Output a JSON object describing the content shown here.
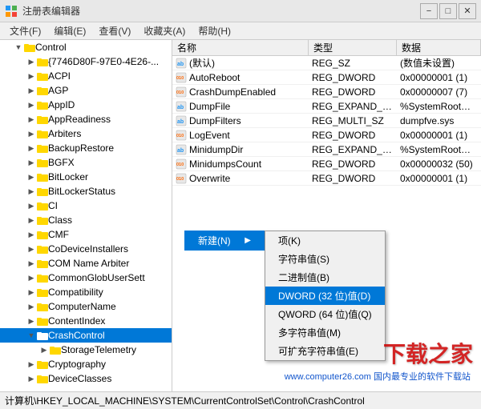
{
  "titleBar": {
    "title": "注册表编辑器",
    "minBtn": "−",
    "maxBtn": "□",
    "closeBtn": "✕"
  },
  "menuBar": {
    "items": [
      "文件(F)",
      "编辑(E)",
      "查看(V)",
      "收藏夹(A)",
      "帮助(H)"
    ]
  },
  "tableHeader": {
    "nameCol": "名称",
    "typeCol": "类型",
    "dataCol": "数据"
  },
  "tableRows": [
    {
      "name": "(默认)",
      "type": "REG_SZ",
      "data": "(数值未设置)",
      "iconType": "ab"
    },
    {
      "name": "AutoReboot",
      "type": "REG_DWORD",
      "data": "0x00000001 (1)",
      "iconType": "dword"
    },
    {
      "name": "CrashDumpEnabled",
      "type": "REG_DWORD",
      "data": "0x00000007 (7)",
      "iconType": "dword"
    },
    {
      "name": "DumpFile",
      "type": "REG_EXPAND_SZ",
      "data": "%SystemRoot%\\MEM",
      "iconType": "ab"
    },
    {
      "name": "DumpFilters",
      "type": "REG_MULTI_SZ",
      "data": "dumpfve.sys",
      "iconType": "ab"
    },
    {
      "name": "LogEvent",
      "type": "REG_DWORD",
      "data": "0x00000001 (1)",
      "iconType": "dword"
    },
    {
      "name": "MinidumpDir",
      "type": "REG_EXPAND_SZ",
      "data": "%SystemRoot%\\Minid",
      "iconType": "ab"
    },
    {
      "name": "MinidumpsCount",
      "type": "REG_DWORD",
      "data": "0x00000032 (50)",
      "iconType": "dword"
    },
    {
      "name": "Overwrite",
      "type": "REG_DWORD",
      "data": "0x00000001 (1)",
      "iconType": "dword"
    }
  ],
  "treeItems": [
    {
      "label": "Control",
      "indent": 1,
      "expanded": true,
      "selected": false
    },
    {
      "label": "{7746D80F-97E0-4E26-...",
      "indent": 2,
      "expanded": false,
      "selected": false
    },
    {
      "label": "ACPI",
      "indent": 2,
      "expanded": false,
      "selected": false
    },
    {
      "label": "AGP",
      "indent": 2,
      "expanded": false,
      "selected": false
    },
    {
      "label": "AppID",
      "indent": 2,
      "expanded": false,
      "selected": false
    },
    {
      "label": "AppReadiness",
      "indent": 2,
      "expanded": false,
      "selected": false
    },
    {
      "label": "Arbiters",
      "indent": 2,
      "expanded": false,
      "selected": false
    },
    {
      "label": "BackupRestore",
      "indent": 2,
      "expanded": false,
      "selected": false
    },
    {
      "label": "BGFX",
      "indent": 2,
      "expanded": false,
      "selected": false
    },
    {
      "label": "BitLocker",
      "indent": 2,
      "expanded": false,
      "selected": false
    },
    {
      "label": "BitLockerStatus",
      "indent": 2,
      "expanded": false,
      "selected": false
    },
    {
      "label": "CI",
      "indent": 2,
      "expanded": false,
      "selected": false
    },
    {
      "label": "Class",
      "indent": 2,
      "expanded": false,
      "selected": false
    },
    {
      "label": "CMF",
      "indent": 2,
      "expanded": false,
      "selected": false
    },
    {
      "label": "CoDeviceInstallers",
      "indent": 2,
      "expanded": false,
      "selected": false
    },
    {
      "label": "COM Name Arbiter",
      "indent": 2,
      "expanded": false,
      "selected": false
    },
    {
      "label": "CommonGlobUserSett",
      "indent": 2,
      "expanded": false,
      "selected": false
    },
    {
      "label": "Compatibility",
      "indent": 2,
      "expanded": false,
      "selected": false
    },
    {
      "label": "ComputerName",
      "indent": 2,
      "expanded": false,
      "selected": false
    },
    {
      "label": "ContentIndex",
      "indent": 2,
      "expanded": false,
      "selected": false
    },
    {
      "label": "CrashControl",
      "indent": 2,
      "expanded": true,
      "selected": true
    },
    {
      "label": "StorageTelemetry",
      "indent": 3,
      "expanded": false,
      "selected": false
    },
    {
      "label": "Cryptography",
      "indent": 2,
      "expanded": false,
      "selected": false
    },
    {
      "label": "DeviceClasses",
      "indent": 2,
      "expanded": false,
      "selected": false
    }
  ],
  "contextMenu": {
    "newLabel": "新建(N)",
    "arrowChar": "▶",
    "items": [
      "项(K)",
      "字符串值(S)",
      "二进制值(B)",
      "DWORD (32 位)值(D)",
      "QWORD (64 位)值(Q)",
      "多字符串值(M)",
      "可扩充字符串值(E)"
    ]
  },
  "statusBar": {
    "text": "计算机\\HKEY_LOCAL_MACHINE\\SYSTEM\\CurrentControlSet\\Control\\CrashControl"
  },
  "watermark": {
    "line1": "下载之家",
    "line2": "www.computer26.com  国内最专业的软件下载站"
  }
}
